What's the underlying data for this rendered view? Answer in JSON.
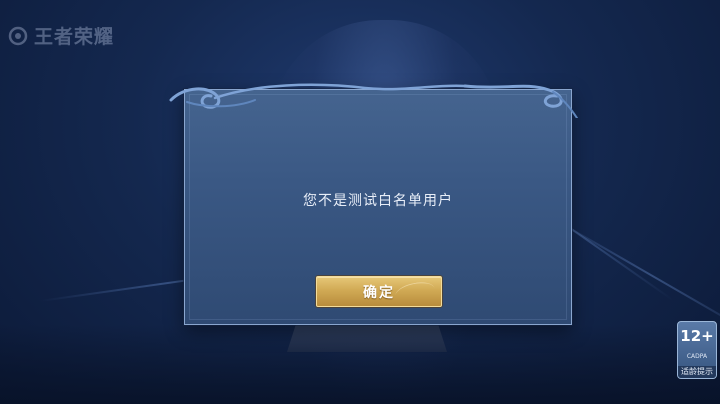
{
  "app": {
    "logo_text": "王者荣耀",
    "logo_icon": "game-logo-icon"
  },
  "dialog": {
    "message": "您不是测试白名单用户",
    "confirm_label": "确定",
    "ornament_icon": "cloud-ornament-icon"
  },
  "age_rating": {
    "value": "12+",
    "org": "CADPA",
    "caption": "适龄提示"
  },
  "footer": {
    "notice": ""
  },
  "colors": {
    "dialog_bg": "#3a5884",
    "dialog_border": "#8aa6cf",
    "button_gold": "#d1aa55",
    "background": "#14284f"
  }
}
